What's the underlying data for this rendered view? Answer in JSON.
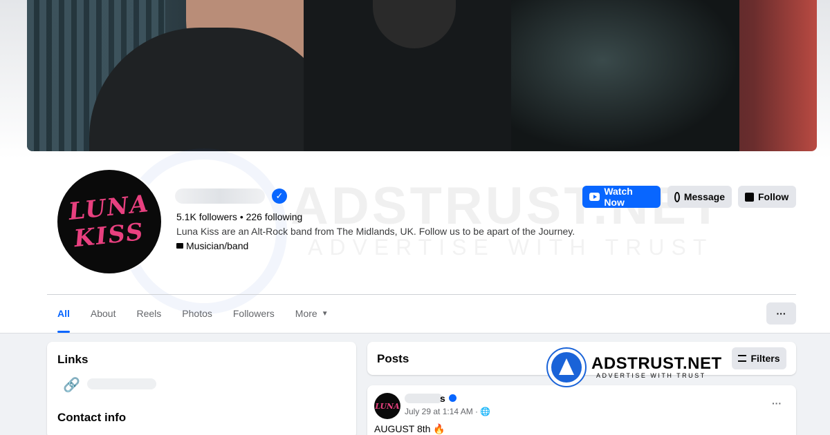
{
  "profile": {
    "stats": "5.1K followers • 226 following",
    "bio": "Luna Kiss are an Alt-Rock band from The Midlands, UK. Follow us to be apart of the Journey.",
    "category": "Musician/band",
    "avatar_logo_line1": "LUNA",
    "avatar_logo_line2": "KISS"
  },
  "actions": {
    "watch_now": "Watch Now",
    "message": "Message",
    "follow": "Follow"
  },
  "tabs": {
    "all": "All",
    "about": "About",
    "reels": "Reels",
    "photos": "Photos",
    "followers": "Followers",
    "more": "More",
    "more_caret": "▼",
    "overflow": "···"
  },
  "sidebar": {
    "links_title": "Links",
    "contact_title": "Contact info",
    "link_icon": "🔗"
  },
  "posts": {
    "title": "Posts",
    "filters": "Filters",
    "post": {
      "name_tail": "s",
      "time": "July 29 at 1:14 AM · 🌐",
      "text": "AUGUST 8th",
      "emoji": "🔥",
      "menu": "···"
    }
  },
  "watermark": {
    "title": "ADSTRUST.NET",
    "subtitle": "ADVERTISE WITH TRUST"
  },
  "colors": {
    "accent": "#0866ff",
    "brand_pink": "#e8407f"
  }
}
